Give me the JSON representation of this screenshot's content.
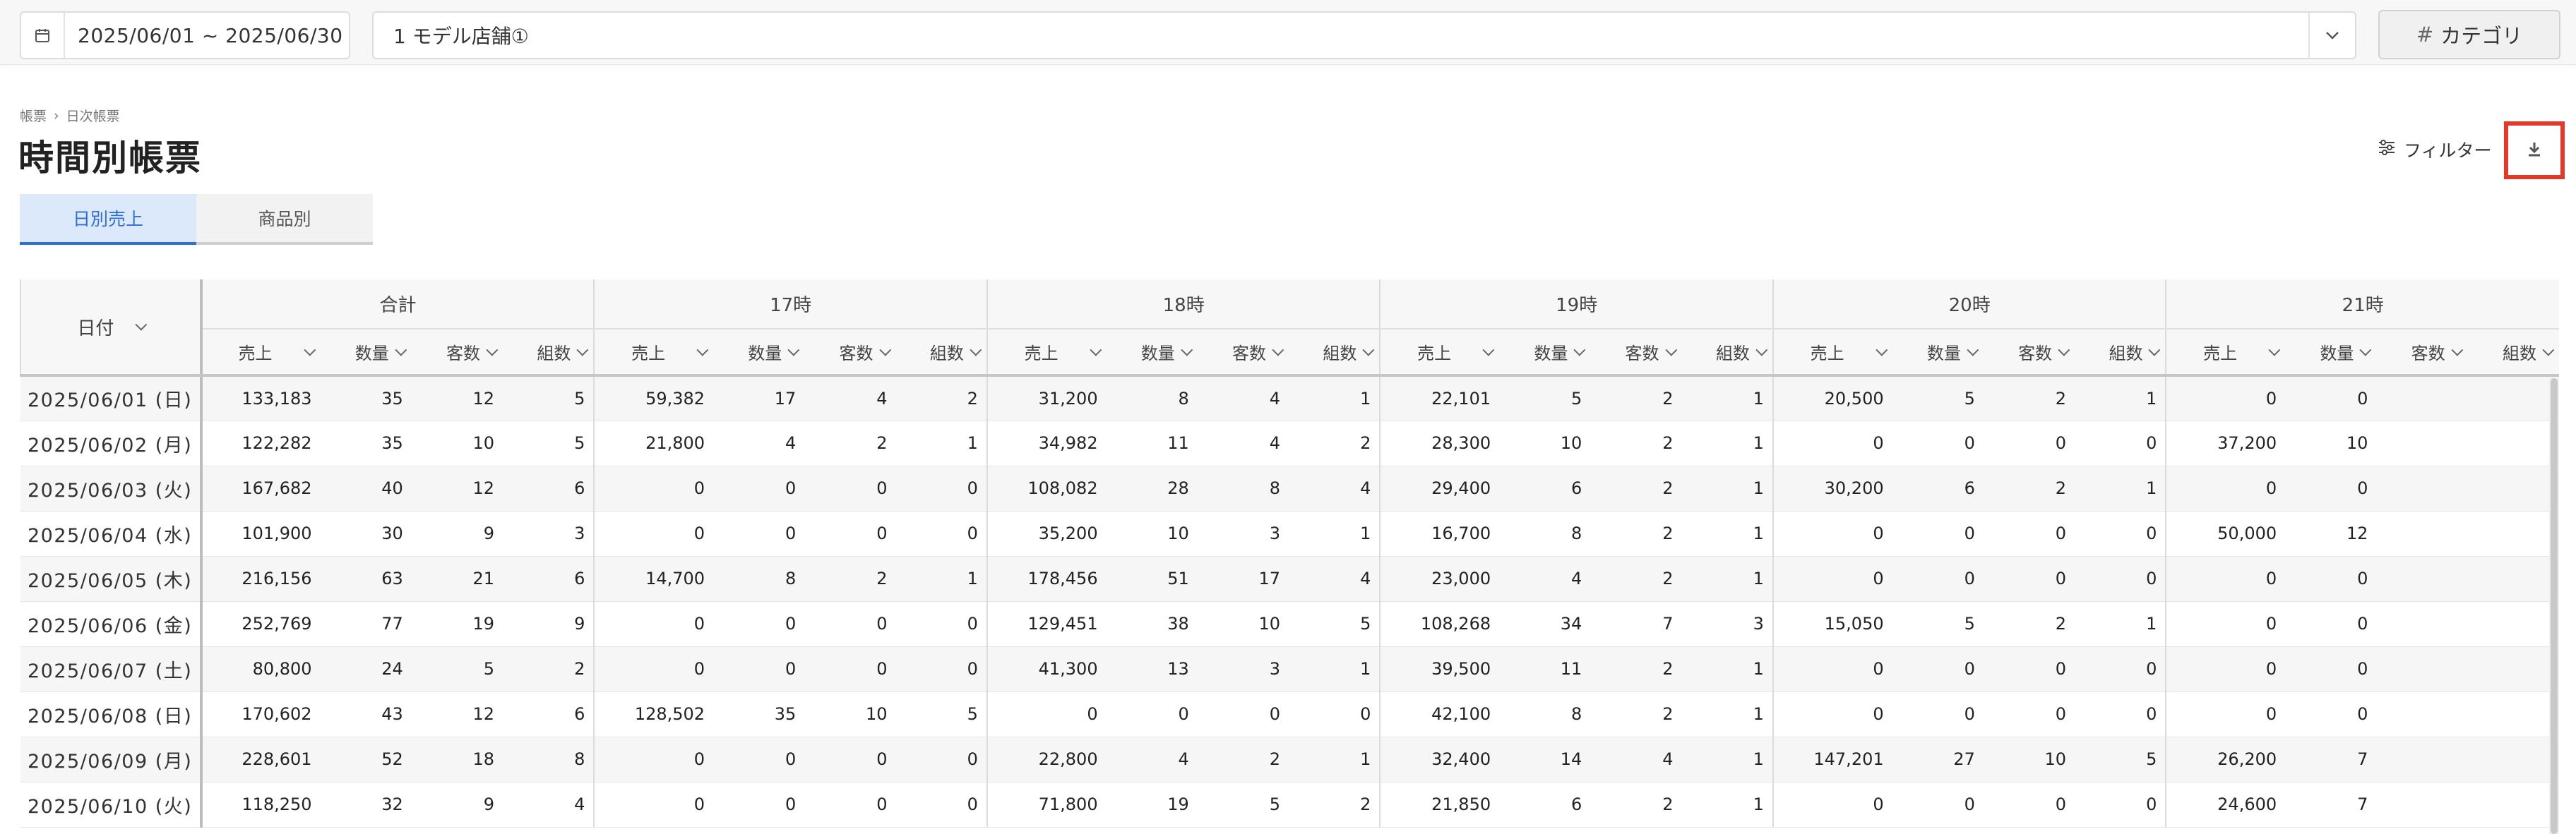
{
  "topbar": {
    "date_range": "2025/06/01 ~ 2025/06/30",
    "store": "1 モデル店舗①",
    "category_label": "カテゴリ",
    "category_icon": "#"
  },
  "breadcrumb": [
    "帳票",
    "日次帳票"
  ],
  "page_title": "時間別帳票",
  "actions": {
    "filter_label": "フィルター"
  },
  "tabs": [
    {
      "label": "日別売上",
      "active": true
    },
    {
      "label": "商品別",
      "active": false
    }
  ],
  "table": {
    "date_header": "日付",
    "groups": [
      "合計",
      "17時",
      "18時",
      "19時",
      "20時",
      "21時"
    ],
    "metrics": [
      "売上",
      "数量",
      "客数",
      "組数"
    ],
    "rows": [
      {
        "date": "2025/06/01 (日)",
        "cells": [
          "133,183",
          "35",
          "12",
          "5",
          "59,382",
          "17",
          "4",
          "2",
          "31,200",
          "8",
          "4",
          "1",
          "22,101",
          "5",
          "2",
          "1",
          "20,500",
          "5",
          "2",
          "1",
          "0",
          "0",
          "",
          ""
        ]
      },
      {
        "date": "2025/06/02 (月)",
        "cells": [
          "122,282",
          "35",
          "10",
          "5",
          "21,800",
          "4",
          "2",
          "1",
          "34,982",
          "11",
          "4",
          "2",
          "28,300",
          "10",
          "2",
          "1",
          "0",
          "0",
          "0",
          "0",
          "37,200",
          "10",
          "",
          ""
        ]
      },
      {
        "date": "2025/06/03 (火)",
        "cells": [
          "167,682",
          "40",
          "12",
          "6",
          "0",
          "0",
          "0",
          "0",
          "108,082",
          "28",
          "8",
          "4",
          "29,400",
          "6",
          "2",
          "1",
          "30,200",
          "6",
          "2",
          "1",
          "0",
          "0",
          "",
          ""
        ]
      },
      {
        "date": "2025/06/04 (水)",
        "cells": [
          "101,900",
          "30",
          "9",
          "3",
          "0",
          "0",
          "0",
          "0",
          "35,200",
          "10",
          "3",
          "1",
          "16,700",
          "8",
          "2",
          "1",
          "0",
          "0",
          "0",
          "0",
          "50,000",
          "12",
          "",
          ""
        ]
      },
      {
        "date": "2025/06/05 (木)",
        "cells": [
          "216,156",
          "63",
          "21",
          "6",
          "14,700",
          "8",
          "2",
          "1",
          "178,456",
          "51",
          "17",
          "4",
          "23,000",
          "4",
          "2",
          "1",
          "0",
          "0",
          "0",
          "0",
          "0",
          "0",
          "",
          ""
        ]
      },
      {
        "date": "2025/06/06 (金)",
        "cells": [
          "252,769",
          "77",
          "19",
          "9",
          "0",
          "0",
          "0",
          "0",
          "129,451",
          "38",
          "10",
          "5",
          "108,268",
          "34",
          "7",
          "3",
          "15,050",
          "5",
          "2",
          "1",
          "0",
          "0",
          "",
          ""
        ]
      },
      {
        "date": "2025/06/07 (土)",
        "cells": [
          "80,800",
          "24",
          "5",
          "2",
          "0",
          "0",
          "0",
          "0",
          "41,300",
          "13",
          "3",
          "1",
          "39,500",
          "11",
          "2",
          "1",
          "0",
          "0",
          "0",
          "0",
          "0",
          "0",
          "",
          ""
        ]
      },
      {
        "date": "2025/06/08 (日)",
        "cells": [
          "170,602",
          "43",
          "12",
          "6",
          "128,502",
          "35",
          "10",
          "5",
          "0",
          "0",
          "0",
          "0",
          "42,100",
          "8",
          "2",
          "1",
          "0",
          "0",
          "0",
          "0",
          "0",
          "0",
          "",
          ""
        ]
      },
      {
        "date": "2025/06/09 (月)",
        "cells": [
          "228,601",
          "52",
          "18",
          "8",
          "0",
          "0",
          "0",
          "0",
          "22,800",
          "4",
          "2",
          "1",
          "32,400",
          "14",
          "4",
          "1",
          "147,201",
          "27",
          "10",
          "5",
          "26,200",
          "7",
          "",
          ""
        ]
      },
      {
        "date": "2025/06/10 (火)",
        "cells": [
          "118,250",
          "32",
          "9",
          "4",
          "0",
          "0",
          "0",
          "0",
          "71,800",
          "19",
          "5",
          "2",
          "21,850",
          "6",
          "2",
          "1",
          "0",
          "0",
          "0",
          "0",
          "24,600",
          "7",
          "",
          ""
        ]
      }
    ]
  }
}
